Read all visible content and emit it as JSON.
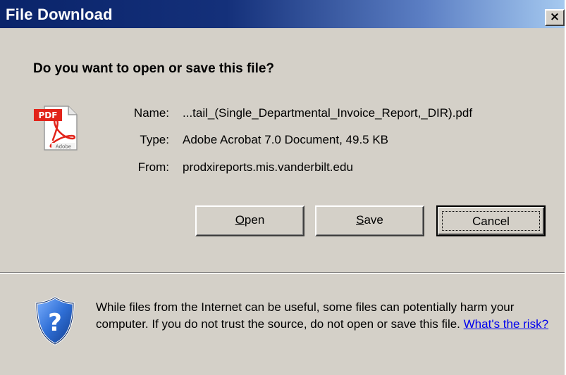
{
  "window": {
    "title": "File Download",
    "close_label": "×"
  },
  "question": "Do you want to open or save this file?",
  "file": {
    "icon": "pdf-file-icon",
    "name_label": "Name:",
    "name_value": "...tail_(Single_Departmental_Invoice_Report,_DIR).pdf",
    "type_label": "Type:",
    "type_value": "Adobe Acrobat 7.0 Document, 49.5 KB",
    "from_label": "From:",
    "from_value": "prodxireports.mis.vanderbilt.edu"
  },
  "buttons": {
    "open_mnemonic": "O",
    "open_rest": "pen",
    "save_mnemonic": "S",
    "save_rest": "ave",
    "cancel_label": "Cancel"
  },
  "warning": {
    "icon": "security-shield-question-icon",
    "text": "While files from the Internet can be useful, some files can potentially harm your computer. If you do not trust the source, do not open or save this file.",
    "link_text": "What's the risk?"
  },
  "colors": {
    "titlebar_start": "#0a246a",
    "titlebar_end": "#a6caf0",
    "dialog_face": "#d4d0c8",
    "link": "#0000ee"
  }
}
